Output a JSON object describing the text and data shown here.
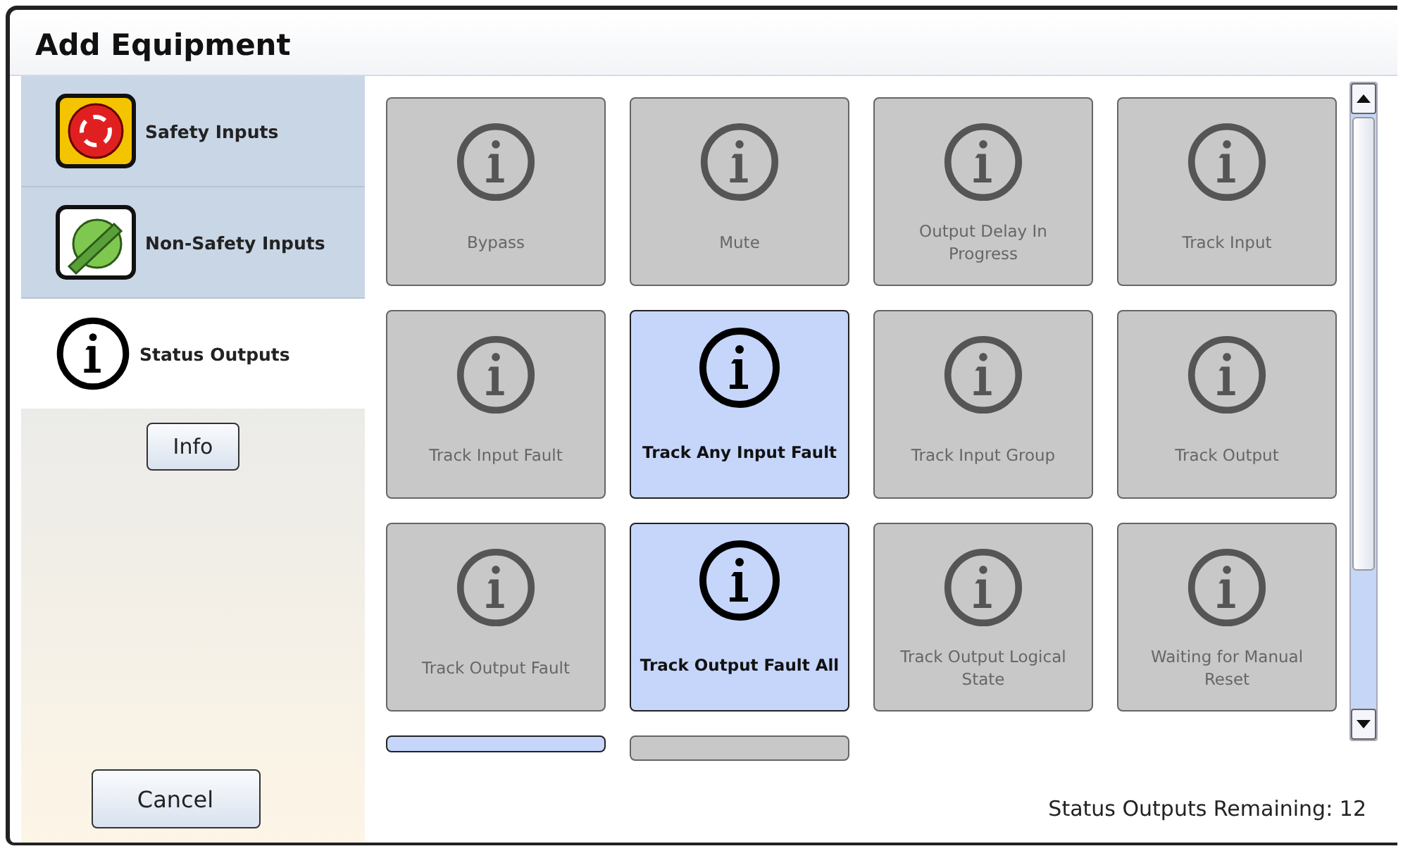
{
  "window": {
    "title": "Add Equipment"
  },
  "categories": [
    {
      "label": "Safety Inputs",
      "kind": "stop-button",
      "selected": false
    },
    {
      "label": "Non-Safety Inputs",
      "kind": "selector-switch",
      "selected": false
    },
    {
      "label": "Status Outputs",
      "kind": "info",
      "selected": true
    }
  ],
  "info_button": "Info",
  "cancel_button": "Cancel",
  "tiles": [
    {
      "label": "Bypass",
      "selected": false
    },
    {
      "label": "Mute",
      "selected": false
    },
    {
      "label": "Output Delay In Progress",
      "selected": false
    },
    {
      "label": "Track Input",
      "selected": false
    },
    {
      "label": "Track Input Fault",
      "selected": false
    },
    {
      "label": "Track Any Input Fault",
      "selected": true
    },
    {
      "label": "Track Input Group",
      "selected": false
    },
    {
      "label": "Track Output",
      "selected": false
    },
    {
      "label": "Track Output Fault",
      "selected": false
    },
    {
      "label": "Track Output Fault All",
      "selected": true
    },
    {
      "label": "Track Output Logical State",
      "selected": false
    },
    {
      "label": "Waiting for Manual Reset",
      "selected": false
    }
  ],
  "cut_off_tiles": [
    {
      "selected": true
    },
    {
      "selected": false
    }
  ],
  "status": "Status Outputs Remaining: 12"
}
